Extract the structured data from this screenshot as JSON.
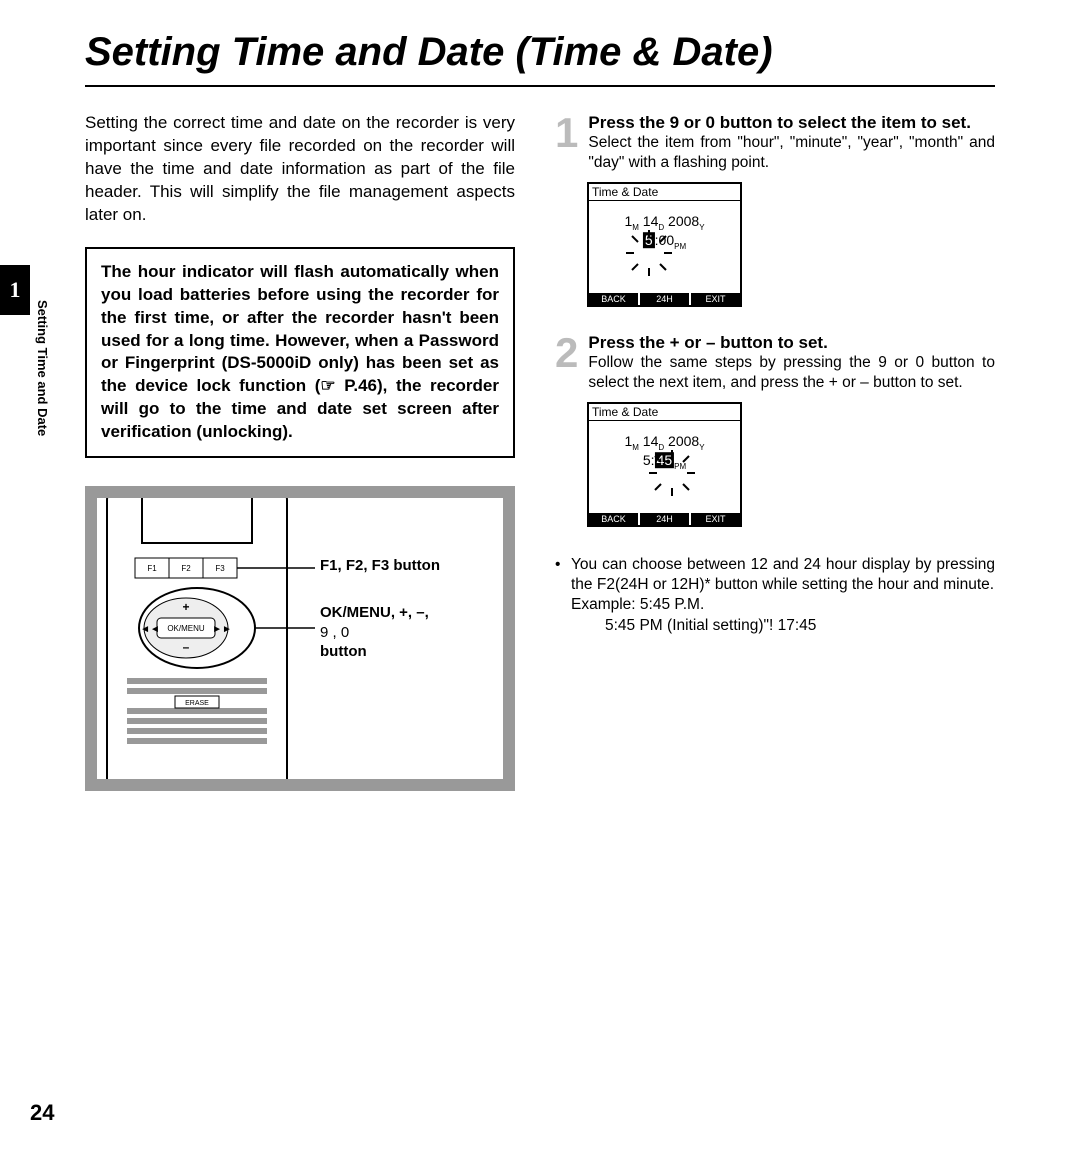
{
  "page_number": "24",
  "chapter_tab": "1",
  "side_label": "Setting Time and Date",
  "title": "Setting Time and Date (Time & Date)",
  "intro": "Setting the correct time and date on the recorder is very important since every file recorded on the recorder will have the time and date information as part of the file header. This will simplify the file management aspects later on.",
  "boxed_note": "The hour indicator will flash automatically when you load batteries before using the recorder for the first time, or after the recorder hasn't been used for a long time. However, when a Password or Fingerprint (DS-5000iD only) has been set as the device lock function (☞ P.46), the recorder will go to the time and date set screen after verification (unlocking).",
  "device_diagram": {
    "f_buttons": [
      "F1",
      "F2",
      "F3"
    ],
    "ok_menu_label": "OK/MENU",
    "erase_label": "ERASE",
    "callout_f": "F1, F2, F3 button",
    "callout_ok_line1": "OK/MENU, +, –,",
    "callout_ok_line2": "9    , 0",
    "callout_ok_line3": "button"
  },
  "steps": [
    {
      "num": "1",
      "head": "Press the 9      or 0      button to select the item to set.",
      "body": "Select the item from \"hour\", \"minute\", \"year\", \"month\" and \"day\" with a flashing point.",
      "screen": {
        "title": "Time & Date",
        "date_month": "1",
        "date_m": "M",
        "date_day": "14",
        "date_d": "D",
        "date_year": "2008",
        "date_y": "Y",
        "time_hour": "5",
        "time_sep": ":",
        "time_min": "00",
        "time_pm": "PM",
        "highlight": "hour",
        "softkeys": [
          "BACK",
          "24H",
          "EXIT"
        ]
      }
    },
    {
      "num": "2",
      "head": "Press the + or – button to set.",
      "body": "Follow the same steps by pressing the 9      or 0      button to select the next item, and press the + or – button to set.",
      "screen": {
        "title": "Time & Date",
        "date_month": "1",
        "date_m": "M",
        "date_day": "14",
        "date_d": "D",
        "date_year": "2008",
        "date_y": "Y",
        "time_hour": "5",
        "time_sep": ":",
        "time_min": "45",
        "time_pm": "PM",
        "highlight": "minute",
        "softkeys": [
          "BACK",
          "24H",
          "EXIT"
        ]
      }
    }
  ],
  "note": {
    "bullet": "•",
    "text": "You can choose between 12 and 24 hour display by pressing the F2(24H or 12H)* button while setting the hour and minute.",
    "example_label": "Example: 5:45 P.M.",
    "example_line": "5:45 PM (Initial setting)\"!     17:45"
  }
}
